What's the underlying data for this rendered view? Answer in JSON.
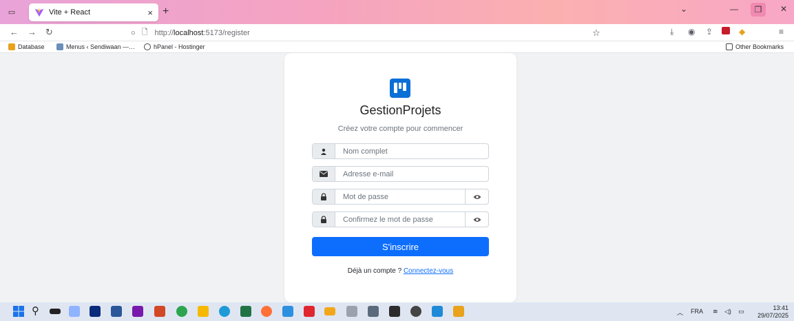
{
  "browser": {
    "tab_title": "Vite + React",
    "tab_close": "×",
    "new_tab": "+",
    "url_prefix": "http://",
    "url_host": "localhost",
    "url_path": ":5173/register",
    "bookmarks": [
      "Database",
      "Menus ‹ Sendiwaan —…",
      "hPanel - Hostinger"
    ],
    "other_bookmarks": "Other Bookmarks"
  },
  "app": {
    "brand": "GestionProjets",
    "subtitle": "Créez votre compte pour commencer",
    "fields": {
      "name_placeholder": "Nom complet",
      "email_placeholder": "Adresse e-mail",
      "password_placeholder": "Mot de passe",
      "confirm_placeholder": "Confirmez le mot de passe"
    },
    "submit_label": "S'inscrire",
    "login_prompt": "Déjà un compte ?",
    "login_link": "Connectez-vous",
    "accent_color": "#0d6efd",
    "logo_color": "#0b6fd6"
  },
  "taskbar": {
    "lang": "FRA",
    "time": "13:41",
    "date": "29/07/2025"
  }
}
